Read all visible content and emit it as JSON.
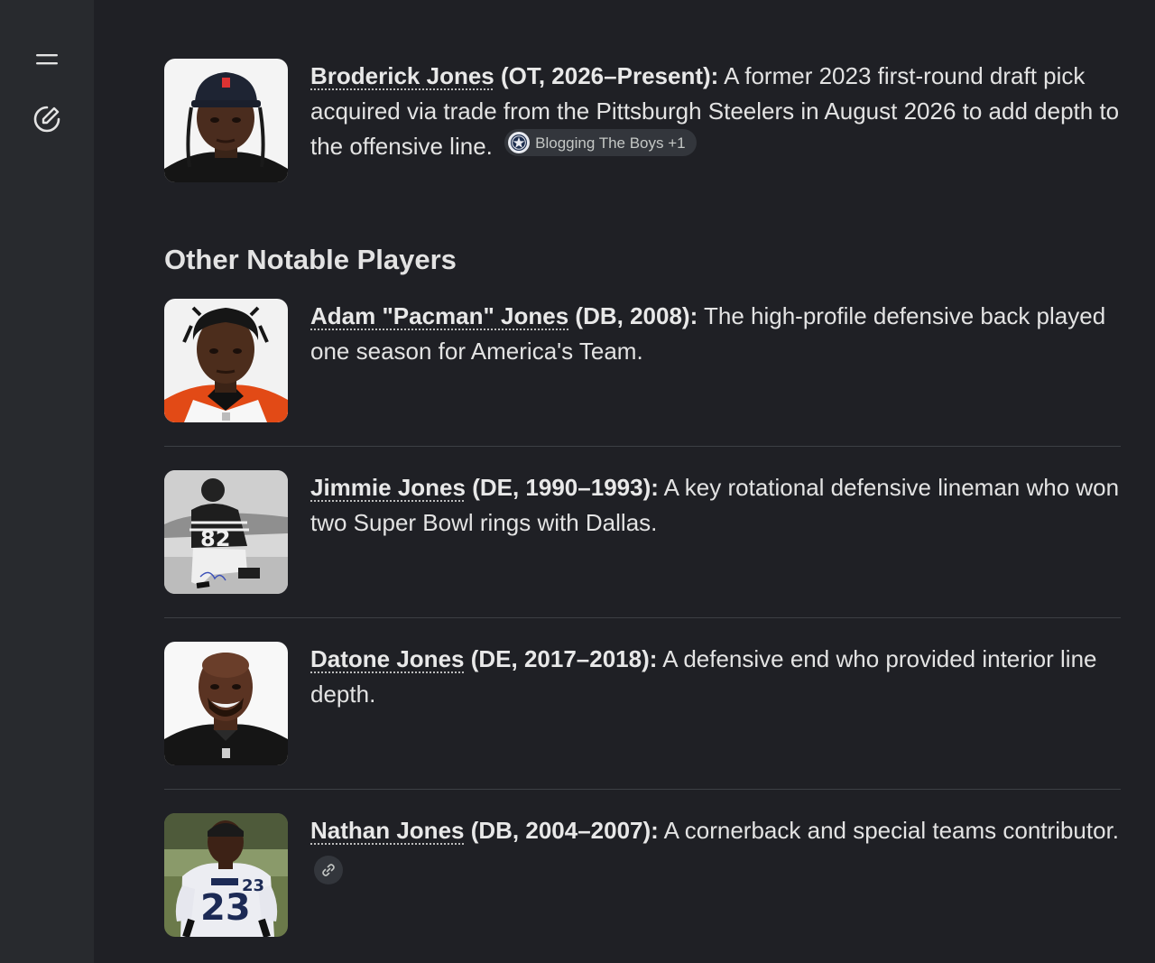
{
  "sidebar": {
    "menu_icon": "menu-icon",
    "new_chat_icon": "edit-pen-icon"
  },
  "entries": [
    {
      "name": "Broderick Jones",
      "role": " (OT, 2026–Present):",
      "desc": " A former 2023 first-round draft pick acquired via trade from the Pittsburgh Steelers in August 2026 to add depth to the offensive line.",
      "source_chip": "Blogging The Boys +1"
    }
  ],
  "section_heading": "Other Notable Players",
  "players": [
    {
      "name": "Adam \"Pacman\" Jones",
      "role": " (DB, 2008):",
      "desc": " The high-profile defensive back played one season for America's Team."
    },
    {
      "name": "Jimmie Jones",
      "role": " (DE, 1990–1993):",
      "desc": " A key rotational defensive lineman who won two Super Bowl rings with Dallas."
    },
    {
      "name": "Datone Jones",
      "role": " (DE, 2017–2018):",
      "desc": " A defensive end who provided interior line depth."
    },
    {
      "name": "Nathan Jones",
      "role": " (DB, 2004–2007):",
      "desc": " A cornerback and special teams contributor."
    }
  ],
  "colors": {
    "background": "#1f2025",
    "sidebar": "#282a2e",
    "chip": "#33363c"
  }
}
